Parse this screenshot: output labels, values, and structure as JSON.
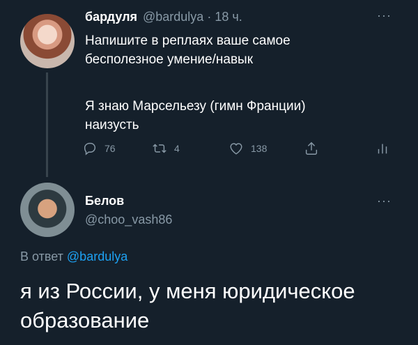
{
  "tweet1": {
    "name": "бардуля",
    "handle": "@bardulya · 18 ч.",
    "text_p1": "Напишите в реплаях ваше самое\nбесполезное умение/навык",
    "text_p2": "Я знаю Марсельезу (гимн Франции)\nнаизусть",
    "more_label": "···",
    "reply_count": "76",
    "retweet_count": "4",
    "like_count": "138"
  },
  "tweet2": {
    "name": "Белов",
    "handle": "@choo_vash86",
    "more_label": "···",
    "reply_to_prefix": "В ответ",
    "reply_to_handle": "@bardulya",
    "text": "я из  России, у меня юридическое образование"
  },
  "colors": {
    "background": "#15202b",
    "muted": "#8899a6",
    "link": "#1da1f2",
    "thread_line": "#38444d"
  },
  "icons": [
    "reply-icon",
    "retweet-icon",
    "like-icon",
    "share-icon",
    "analytics-icon",
    "more-icon"
  ]
}
